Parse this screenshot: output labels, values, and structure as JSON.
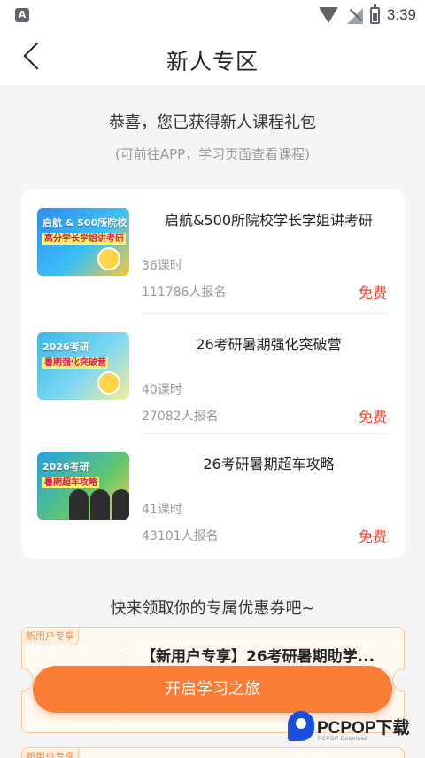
{
  "status_bar": {
    "app_badge": "A",
    "time": "3:39"
  },
  "nav": {
    "title": "新人专区"
  },
  "gift": {
    "heading": "恭喜，您已获得新人课程礼包",
    "subheading": "(可前往APP，学习页面查看课程)"
  },
  "courses": [
    {
      "title": "启航&500所院校学长学姐讲考研",
      "lessons": "36课时",
      "enrolled": "111786人报名",
      "price": "免费",
      "thumb_text": "启航 & 500所院校",
      "thumb_sub": "高分学长学姐讲考研"
    },
    {
      "title": "26考研暑期强化突破营",
      "lessons": "40课时",
      "enrolled": "27082人报名",
      "price": "免费",
      "thumb_text": "2026考研",
      "thumb_sub": "暑期强化突破营"
    },
    {
      "title": "26考研暑期超车攻略",
      "lessons": "41课时",
      "enrolled": "43101人报名",
      "price": "免费",
      "thumb_text": "2026考研",
      "thumb_sub": "暑期超车攻略"
    }
  ],
  "coupons": {
    "heading": "快来领取你的专属优惠券吧~",
    "items": [
      {
        "tag": "新用户专享",
        "title": "【新用户专享】26考研暑期助学..."
      },
      {
        "tag": "新用户专享"
      }
    ]
  },
  "cta": {
    "label": "开启学习之旅"
  },
  "watermark": {
    "brand": "PCPOP下载",
    "sub": "PCPOP Download"
  },
  "colors": {
    "accent": "#f97d35",
    "price": "#f03c2c",
    "coupon_border": "#ffc79a"
  }
}
